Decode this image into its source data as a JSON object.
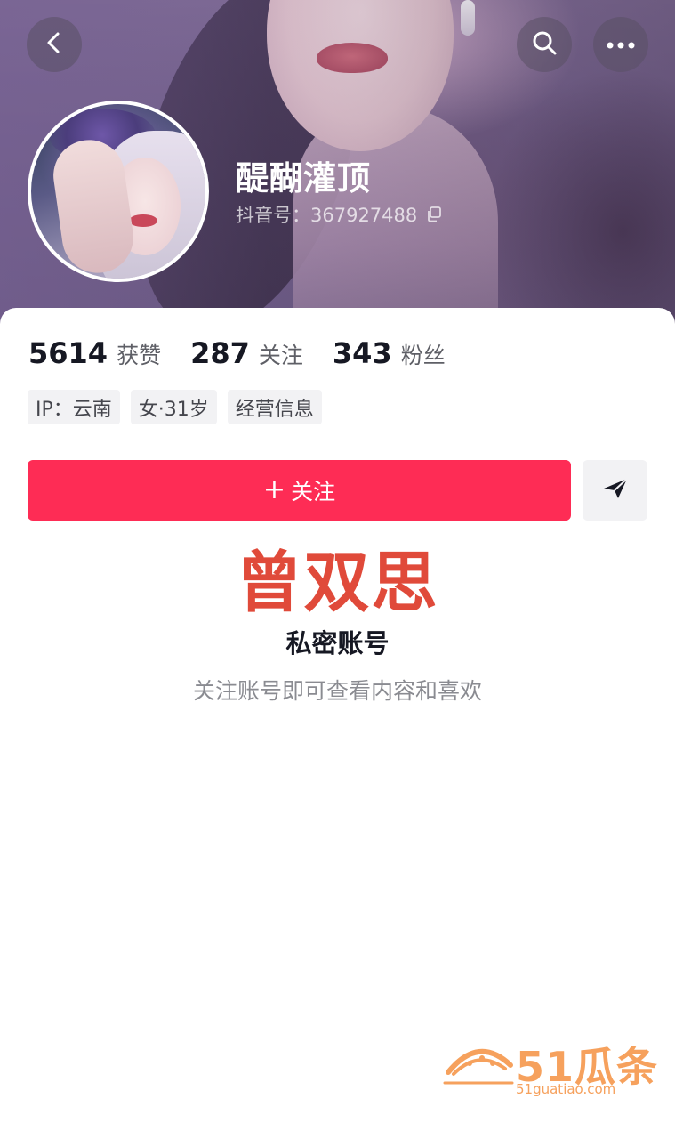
{
  "header": {
    "nickname": "醍醐灌顶",
    "uid_label": "抖音号：367927488"
  },
  "stats": [
    {
      "value": "5614",
      "label": "获赞"
    },
    {
      "value": "287",
      "label": "关注"
    },
    {
      "value": "343",
      "label": "粉丝"
    }
  ],
  "tags": [
    "IP：云南",
    "女·31岁",
    "经营信息"
  ],
  "actions": {
    "follow_plus": "+",
    "follow_label": "关注"
  },
  "overlay_name": "曾双思",
  "private": {
    "title": "私密账号",
    "hint": "关注账号即可查看内容和喜欢"
  },
  "watermark": {
    "brand": "51瓜条",
    "domain": "51guatiao.com"
  },
  "colors": {
    "accent": "#fe2c55",
    "overlay_text": "#e04a3a",
    "watermark": "#f6a15d"
  },
  "icons": {
    "back": "chevron-left-icon",
    "search": "search-icon",
    "more": "more-horizontal-icon",
    "copy": "copy-icon",
    "share": "share-arrow-icon"
  }
}
